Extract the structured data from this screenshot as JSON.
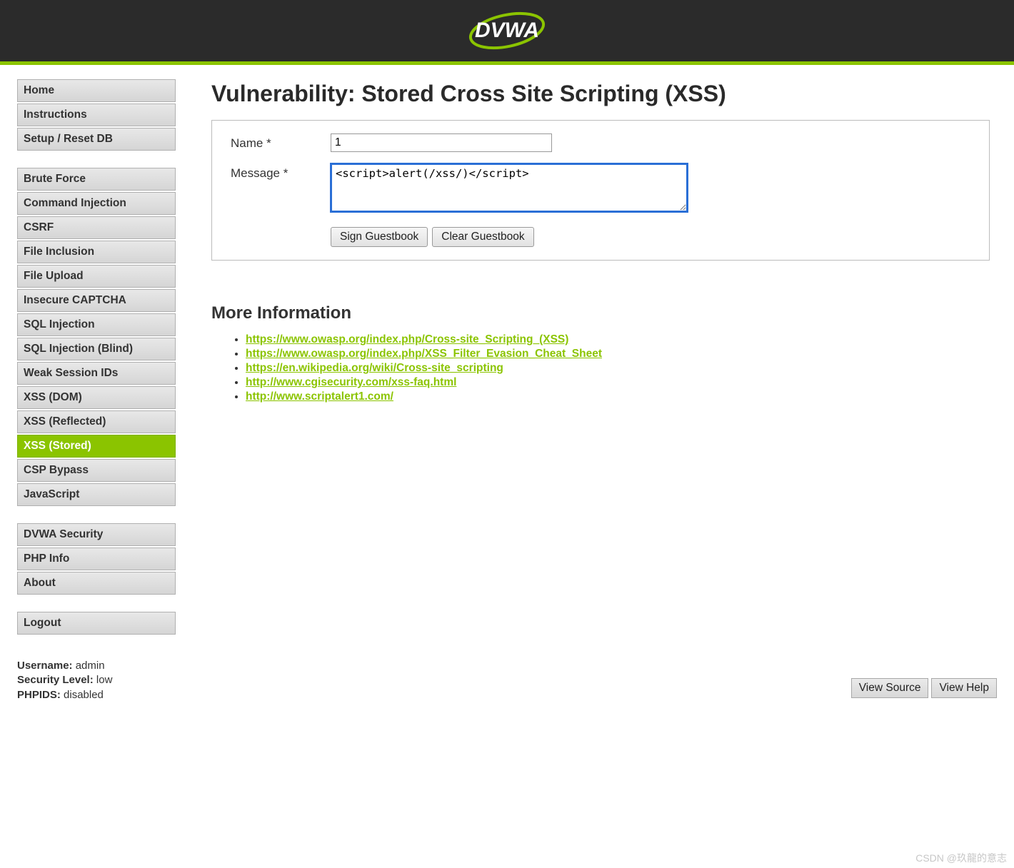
{
  "header": {
    "logo_text": "DVWA"
  },
  "sidebar": {
    "group1": [
      {
        "label": "Home",
        "name": "nav-home",
        "active": false
      },
      {
        "label": "Instructions",
        "name": "nav-instructions",
        "active": false
      },
      {
        "label": "Setup / Reset DB",
        "name": "nav-setup",
        "active": false
      }
    ],
    "group2": [
      {
        "label": "Brute Force",
        "name": "nav-brute-force",
        "active": false
      },
      {
        "label": "Command Injection",
        "name": "nav-command-injection",
        "active": false
      },
      {
        "label": "CSRF",
        "name": "nav-csrf",
        "active": false
      },
      {
        "label": "File Inclusion",
        "name": "nav-file-inclusion",
        "active": false
      },
      {
        "label": "File Upload",
        "name": "nav-file-upload",
        "active": false
      },
      {
        "label": "Insecure CAPTCHA",
        "name": "nav-insecure-captcha",
        "active": false
      },
      {
        "label": "SQL Injection",
        "name": "nav-sql-injection",
        "active": false
      },
      {
        "label": "SQL Injection (Blind)",
        "name": "nav-sql-injection-blind",
        "active": false
      },
      {
        "label": "Weak Session IDs",
        "name": "nav-weak-session",
        "active": false
      },
      {
        "label": "XSS (DOM)",
        "name": "nav-xss-dom",
        "active": false
      },
      {
        "label": "XSS (Reflected)",
        "name": "nav-xss-reflected",
        "active": false
      },
      {
        "label": "XSS (Stored)",
        "name": "nav-xss-stored",
        "active": true
      },
      {
        "label": "CSP Bypass",
        "name": "nav-csp-bypass",
        "active": false
      },
      {
        "label": "JavaScript",
        "name": "nav-javascript",
        "active": false
      }
    ],
    "group3": [
      {
        "label": "DVWA Security",
        "name": "nav-dvwa-security",
        "active": false
      },
      {
        "label": "PHP Info",
        "name": "nav-php-info",
        "active": false
      },
      {
        "label": "About",
        "name": "nav-about",
        "active": false
      }
    ],
    "group4": [
      {
        "label": "Logout",
        "name": "nav-logout",
        "active": false
      }
    ]
  },
  "status": {
    "username_label": "Username:",
    "username_value": "admin",
    "security_label": "Security Level:",
    "security_value": "low",
    "phpids_label": "PHPIDS:",
    "phpids_value": "disabled"
  },
  "main": {
    "title": "Vulnerability: Stored Cross Site Scripting (XSS)",
    "form": {
      "name_label": "Name *",
      "name_value": "1",
      "message_label": "Message *",
      "message_value": "<script>alert(/xss/)</script>",
      "sign_btn": "Sign Guestbook",
      "clear_btn": "Clear Guestbook"
    },
    "info_heading": "More Information",
    "info_links": [
      "https://www.owasp.org/index.php/Cross-site_Scripting_(XSS)",
      "https://www.owasp.org/index.php/XSS_Filter_Evasion_Cheat_Sheet",
      "https://en.wikipedia.org/wiki/Cross-site_scripting",
      "http://www.cgisecurity.com/xss-faq.html",
      "http://www.scriptalert1.com/"
    ]
  },
  "footer": {
    "view_source": "View Source",
    "view_help": "View Help"
  },
  "watermark": "CSDN @玖龍的意志"
}
